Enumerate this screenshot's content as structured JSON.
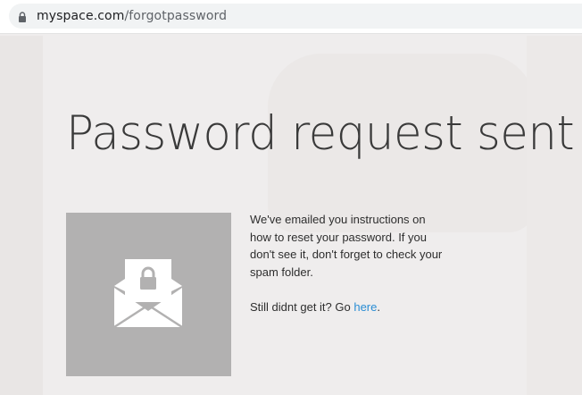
{
  "browser": {
    "url_host": "myspace.com",
    "url_path": "/forgotpassword",
    "icon": "lock-icon"
  },
  "page": {
    "title": "Password request sent",
    "illustration_icon": "locked-envelope-icon",
    "message": "We've emailed you instructions on how to reset your password. If you don't see it, don't forget to check your spam folder.",
    "retry_prefix": "Still didnt get it? Go ",
    "retry_link": "here",
    "retry_suffix": "."
  },
  "colors": {
    "link": "#2a8dd4",
    "illustration_bg": "#b2b1b1"
  }
}
